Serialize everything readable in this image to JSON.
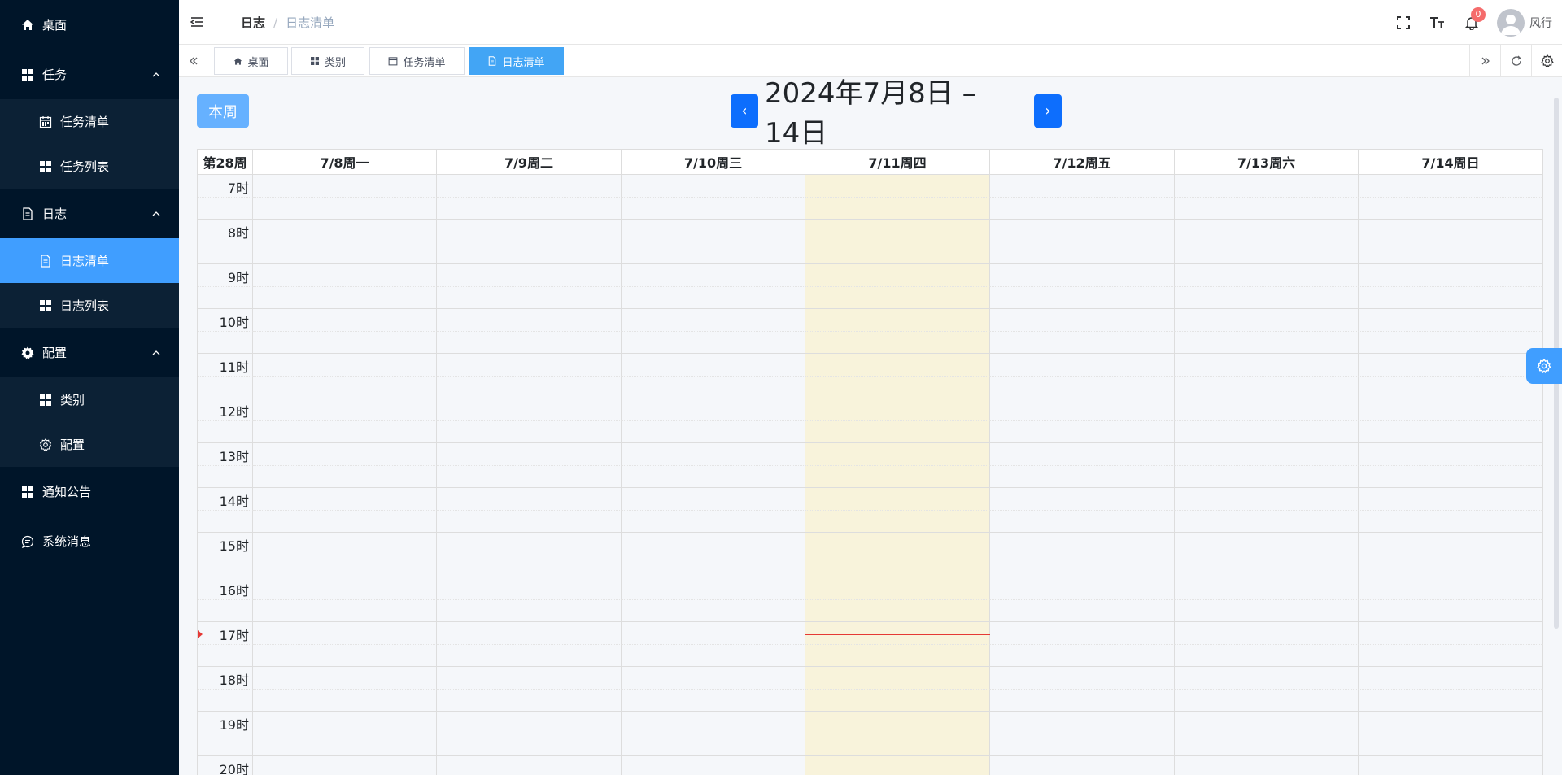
{
  "sidebar": {
    "items": [
      {
        "label": "桌面",
        "icon": "home-icon"
      },
      {
        "label": "任务",
        "icon": "grid-icon",
        "children": [
          {
            "label": "任务清单",
            "icon": "calendar-icon"
          },
          {
            "label": "任务列表",
            "icon": "grid-icon"
          }
        ]
      },
      {
        "label": "日志",
        "icon": "document-icon",
        "children": [
          {
            "label": "日志清单",
            "icon": "document-icon",
            "active": true
          },
          {
            "label": "日志列表",
            "icon": "grid-icon"
          }
        ]
      },
      {
        "label": "配置",
        "icon": "gear-icon",
        "children": [
          {
            "label": "类别",
            "icon": "grid-icon"
          },
          {
            "label": "配置",
            "icon": "gear-outline-icon"
          }
        ]
      },
      {
        "label": "通知公告",
        "icon": "grid-icon"
      },
      {
        "label": "系统消息",
        "icon": "chat-icon"
      }
    ]
  },
  "header": {
    "breadcrumb": {
      "parent": "日志",
      "separator": "/",
      "current": "日志清单"
    },
    "notification_count": "0",
    "username": "风行"
  },
  "tags": [
    {
      "label": "桌面",
      "icon": "home-icon"
    },
    {
      "label": "类别",
      "icon": "grid-icon"
    },
    {
      "label": "任务清单",
      "icon": "calendar-icon"
    },
    {
      "label": "日志清单",
      "icon": "document-icon",
      "active": true
    }
  ],
  "calendar": {
    "this_week_label": "本周",
    "prev_label": "‹",
    "next_label": "›",
    "title": "2024年7月8日 – 14日",
    "week_label": "第28周",
    "days": [
      "7/8周一",
      "7/9周二",
      "7/10周三",
      "7/11周四",
      "7/12周五",
      "7/13周六",
      "7/14周日"
    ],
    "today_index": 3,
    "hours": [
      "7时",
      "8时",
      "9时",
      "10时",
      "11时",
      "12时",
      "13时",
      "14时",
      "15时",
      "16时",
      "17时",
      "18时",
      "19时",
      "20时"
    ],
    "now_hour_index": 10
  },
  "colors": {
    "sidebar_bg": "#001529",
    "active": "#409eff",
    "today": "#f8f3db",
    "now_indicator": "#e53935",
    "nav_button": "#0d6efd"
  }
}
